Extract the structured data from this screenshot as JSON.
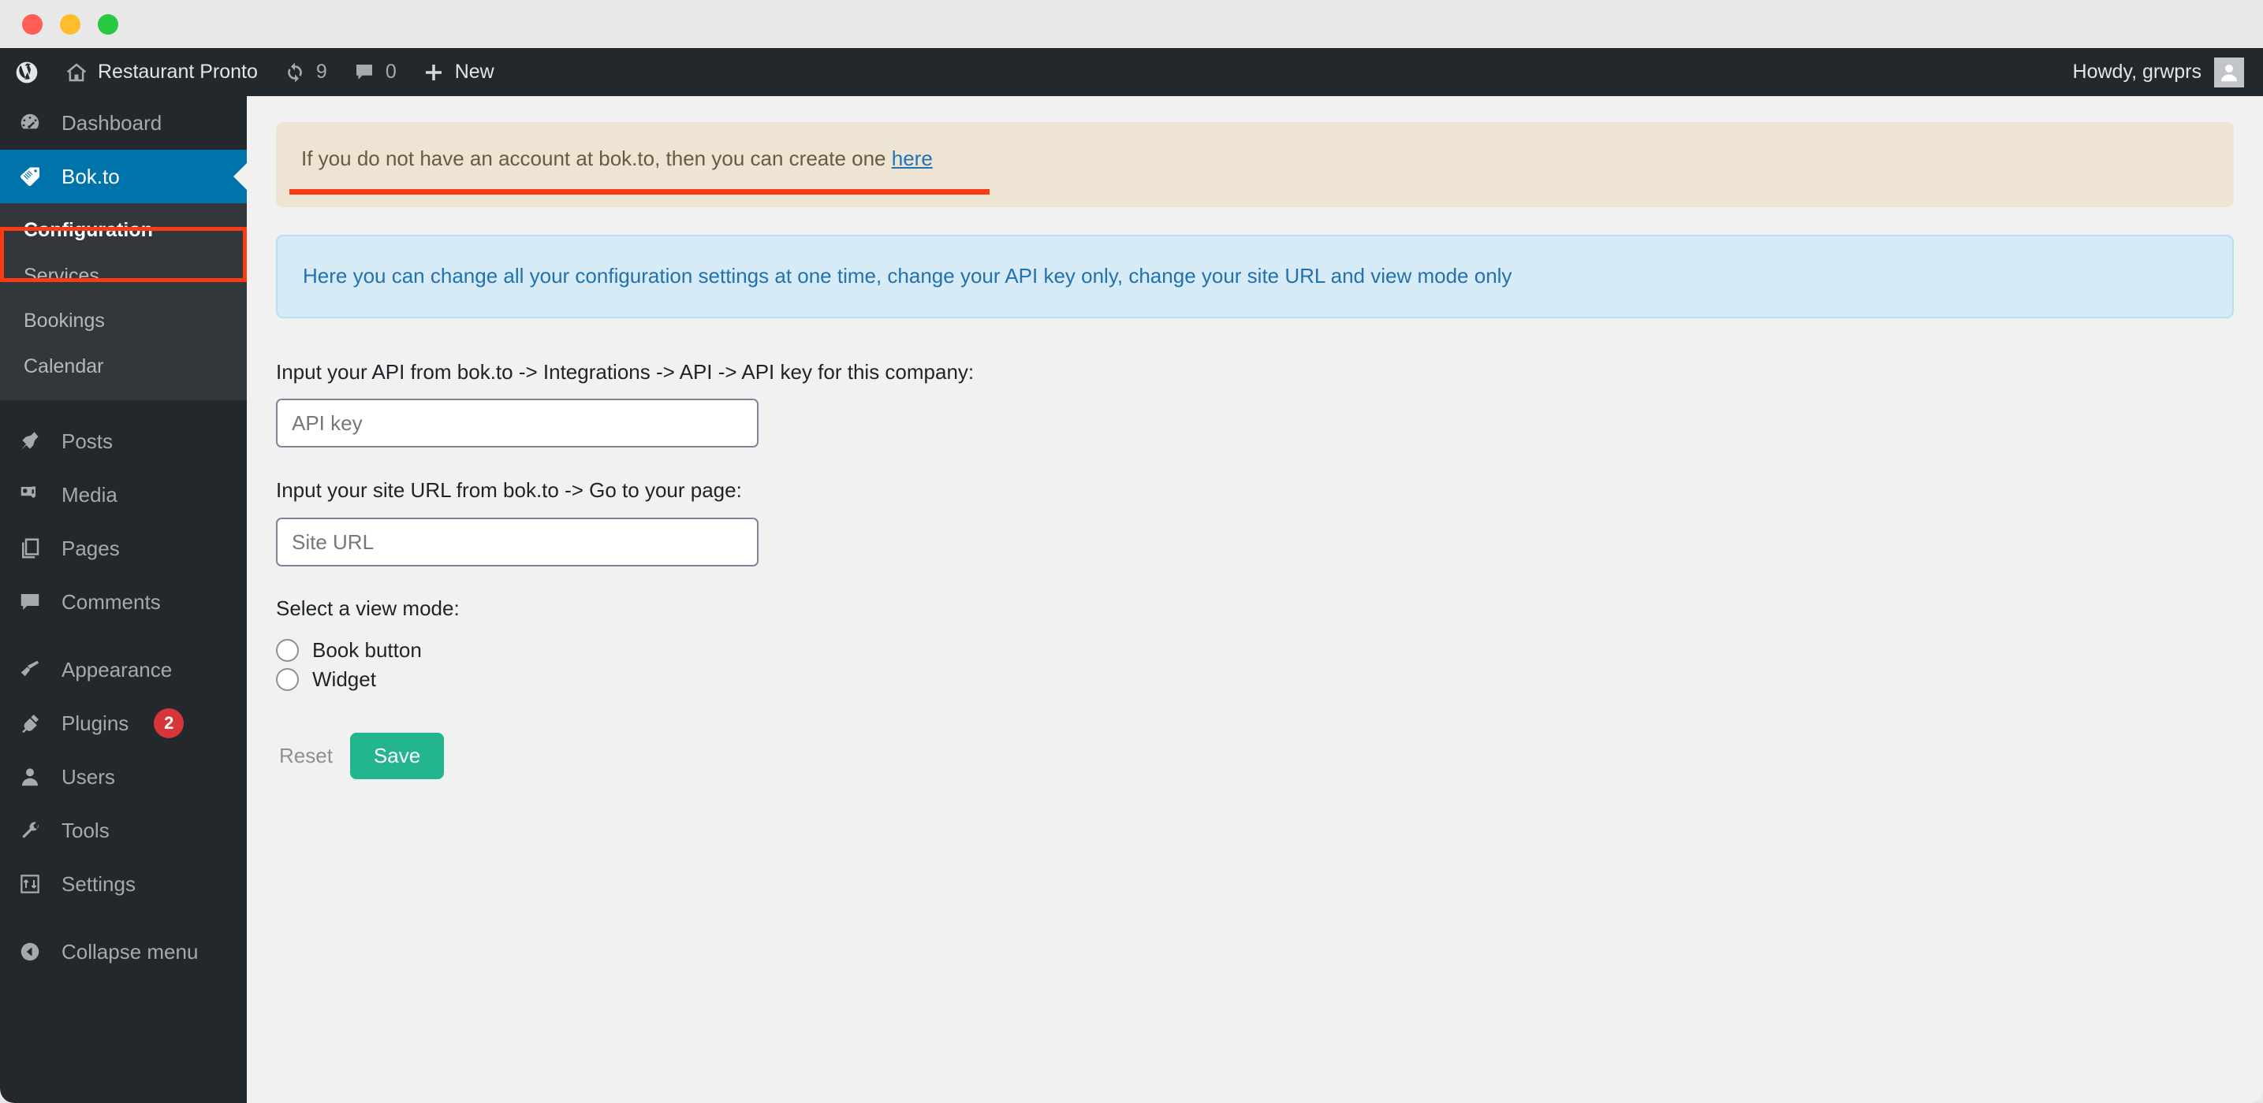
{
  "window": {
    "traffic_lights": [
      {
        "name": "close",
        "color": "#ff5f57"
      },
      {
        "name": "minimize",
        "color": "#ffbd2e"
      },
      {
        "name": "maximize",
        "color": "#28c840"
      }
    ]
  },
  "adminbar": {
    "site_title": "Restaurant Pronto",
    "updates_count": "9",
    "comments_count": "0",
    "new_label": "New",
    "howdy": "Howdy, grwprs"
  },
  "sidebar": {
    "items": [
      {
        "label": "Dashboard",
        "icon": "dashboard-icon",
        "current": false
      },
      {
        "label": "Bok.to",
        "icon": "bokto-icon",
        "current": true
      },
      {
        "label": "Posts",
        "icon": "posts-pin-icon",
        "current": false
      },
      {
        "label": "Media",
        "icon": "media-icon",
        "current": false
      },
      {
        "label": "Pages",
        "icon": "pages-icon",
        "current": false
      },
      {
        "label": "Comments",
        "icon": "comments-icon",
        "current": false
      },
      {
        "label": "Appearance",
        "icon": "appearance-brush-icon",
        "current": false
      },
      {
        "label": "Plugins",
        "icon": "plugins-plug-icon",
        "current": false,
        "badge": "2"
      },
      {
        "label": "Users",
        "icon": "users-icon",
        "current": false
      },
      {
        "label": "Tools",
        "icon": "tools-wrench-icon",
        "current": false
      },
      {
        "label": "Settings",
        "icon": "settings-sliders-icon",
        "current": false
      },
      {
        "label": "Collapse menu",
        "icon": "collapse-arrow-icon",
        "current": false
      }
    ],
    "submenu": [
      {
        "label": "Configuration",
        "active": true
      },
      {
        "label": "Services",
        "active": false
      },
      {
        "label": "Bookings",
        "active": false
      },
      {
        "label": "Calendar",
        "active": false
      }
    ]
  },
  "annotations": {
    "highlight_color": "#fc3a13"
  },
  "main": {
    "notice_warning": {
      "text": "If you do not have an account at bok.to, then you can create one ",
      "link_text": "here"
    },
    "notice_info": {
      "text": "Here you can change all your configuration settings at one time, change your API key only, change your site URL and view mode only"
    },
    "api_key": {
      "label": "Input your API from bok.to -> Integrations -> API -> API key for this company:",
      "placeholder": "API key",
      "value": ""
    },
    "site_url": {
      "label": "Input your site URL from bok.to -> Go to your page:",
      "placeholder": "Site URL",
      "value": ""
    },
    "view_mode": {
      "label": "Select a view mode:",
      "options": [
        {
          "label": "Book button",
          "checked": false
        },
        {
          "label": "Widget",
          "checked": false
        }
      ]
    },
    "buttons": {
      "reset": "Reset",
      "save": "Save",
      "save_color": "#23b68e"
    }
  }
}
